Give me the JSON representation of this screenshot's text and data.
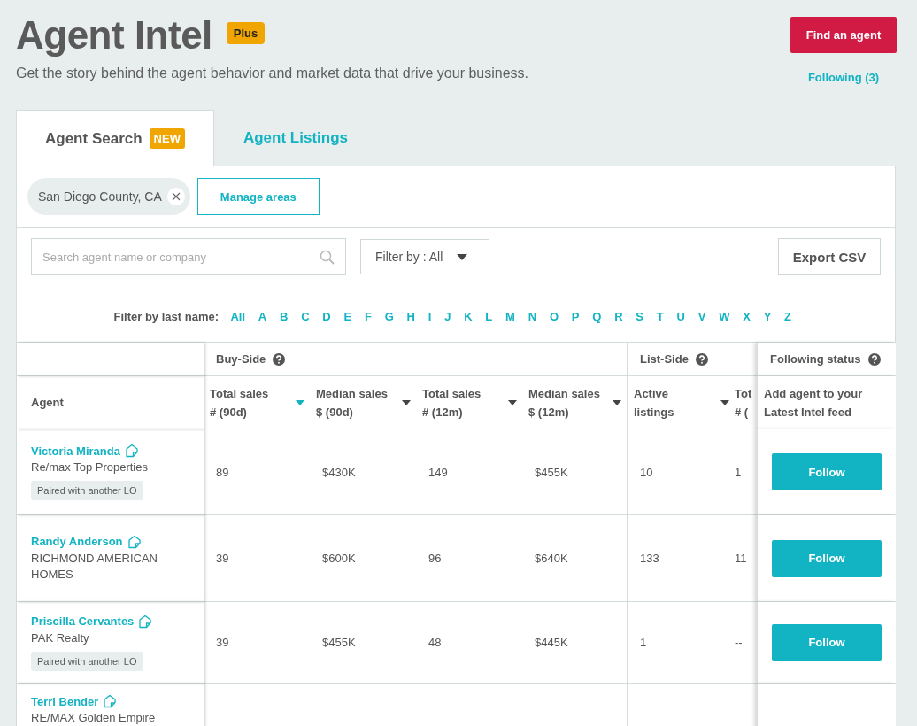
{
  "header": {
    "title": "Agent Intel",
    "badge": "Plus",
    "subtitle": "Get the story behind the agent behavior and market data that drive your business.",
    "primary_button": "Find an agent",
    "following_link": "Following (3)"
  },
  "tabs": [
    {
      "label": "Agent Search",
      "badge": "NEW",
      "selected": true
    },
    {
      "label": "Agent Listings",
      "selected": false
    }
  ],
  "area_chips": [
    "San Diego County, CA"
  ],
  "manage_button": "Manage areas",
  "search": {
    "placeholder": "Search agent name or company"
  },
  "filter_dropdown": "Filter by : All",
  "export_button": "Export CSV",
  "letter_filter": {
    "label": "Filter by last name:",
    "letters": [
      "All",
      "A",
      "B",
      "C",
      "D",
      "E",
      "F",
      "G",
      "H",
      "I",
      "J",
      "K",
      "L",
      "M",
      "N",
      "O",
      "P",
      "Q",
      "R",
      "S",
      "T",
      "U",
      "V",
      "W",
      "X",
      "Y",
      "Z"
    ]
  },
  "table": {
    "groups": [
      {
        "label": "Buy-Side"
      },
      {
        "label": "List-Side"
      },
      {
        "label": "Following status"
      }
    ],
    "columns": [
      {
        "line1": "Agent"
      },
      {
        "line1": "Total sales",
        "line2": "# (90d)",
        "sorted": true
      },
      {
        "line1": "Median sales",
        "line2": "$ (90d)",
        "sorted": false
      },
      {
        "line1": "Total sales",
        "line2": "# (12m)",
        "sorted": false
      },
      {
        "line1": "Median sales",
        "line2": "$ (12m)",
        "sorted": false
      },
      {
        "line1": "Active",
        "line2": "listings",
        "sorted": false
      },
      {
        "line1": "Tot",
        "line2": "# ("
      },
      {
        "line1": "Add agent to your",
        "line2": "Latest Intel feed"
      }
    ],
    "rows": [
      {
        "name": "Victoria Miranda",
        "company": "Re/max Top Properties",
        "tag": "Paired with another LO",
        "values": [
          "89",
          "$430K",
          "149",
          "$455K",
          "10",
          "1"
        ],
        "follow": "Follow"
      },
      {
        "name": "Randy Anderson",
        "company": "RICHMOND AMERICAN HOMES",
        "values": [
          "39",
          "$600K",
          "96",
          "$640K",
          "133",
          "11"
        ],
        "follow": "Follow"
      },
      {
        "name": "Priscilla Cervantes",
        "company": "PAK Realty",
        "tag": "Paired with another LO",
        "values": [
          "39",
          "$455K",
          "48",
          "$445K",
          "1",
          "--"
        ],
        "follow": "Follow"
      },
      {
        "name": "Terri Bender",
        "company": "RE/MAX Golden Empire",
        "values": []
      }
    ]
  }
}
